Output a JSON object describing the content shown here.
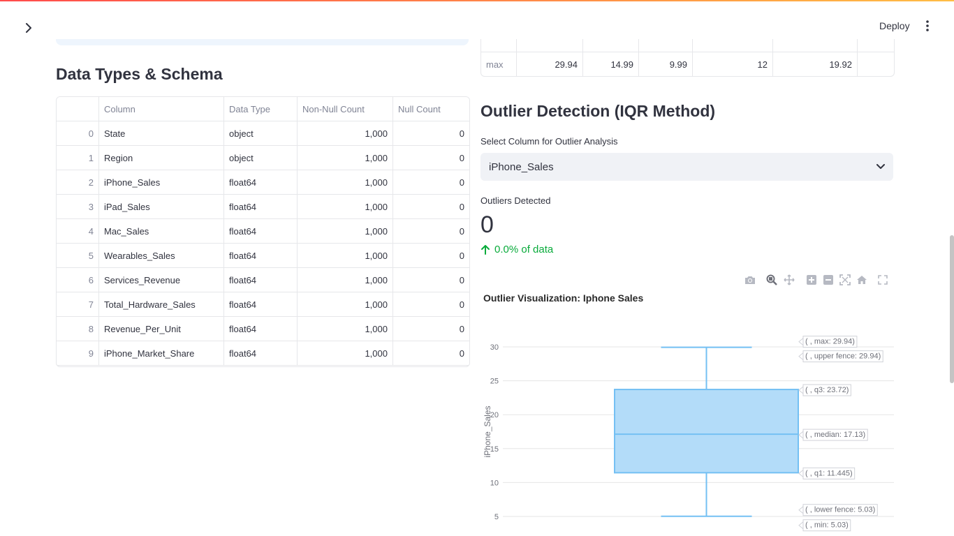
{
  "header": {
    "deploy_label": "Deploy",
    "sidebar_toggle_icon": "chevron-right-icon",
    "menu_icon": "kebab-menu-icon"
  },
  "schema": {
    "title": "Data Types & Schema",
    "columns": [
      "",
      "Column",
      "Data Type",
      "Non-Null Count",
      "Null Count"
    ],
    "rows": [
      {
        "idx": "0",
        "column": "State",
        "dtype": "object",
        "non_null": "1,000",
        "null": "0"
      },
      {
        "idx": "1",
        "column": "Region",
        "dtype": "object",
        "non_null": "1,000",
        "null": "0"
      },
      {
        "idx": "2",
        "column": "iPhone_Sales",
        "dtype": "float64",
        "non_null": "1,000",
        "null": "0"
      },
      {
        "idx": "3",
        "column": "iPad_Sales",
        "dtype": "float64",
        "non_null": "1,000",
        "null": "0"
      },
      {
        "idx": "4",
        "column": "Mac_Sales",
        "dtype": "float64",
        "non_null": "1,000",
        "null": "0"
      },
      {
        "idx": "5",
        "column": "Wearables_Sales",
        "dtype": "float64",
        "non_null": "1,000",
        "null": "0"
      },
      {
        "idx": "6",
        "column": "Services_Revenue",
        "dtype": "float64",
        "non_null": "1,000",
        "null": "0"
      },
      {
        "idx": "7",
        "column": "Total_Hardware_Sales",
        "dtype": "float64",
        "non_null": "1,000",
        "null": "0"
      },
      {
        "idx": "8",
        "column": "Revenue_Per_Unit",
        "dtype": "float64",
        "non_null": "1,000",
        "null": "0"
      },
      {
        "idx": "9",
        "column": "iPhone_Market_Share",
        "dtype": "float64",
        "non_null": "1,000",
        "null": "0"
      }
    ]
  },
  "stats": {
    "max_row": {
      "label": "max",
      "values": [
        "29.94",
        "14.99",
        "9.99",
        "12",
        "19.92",
        ""
      ]
    }
  },
  "outlier": {
    "title": "Outlier Detection (IQR Method)",
    "select_label": "Select Column for Outlier Analysis",
    "select_value": "iPhone_Sales",
    "metric_label": "Outliers Detected",
    "metric_value": "0",
    "metric_delta": "0.0% of data",
    "delta_color": "#09ab3b"
  },
  "chart_data": {
    "type": "box",
    "title": "Outlier Visualization: Iphone Sales",
    "ylabel": "iPhone_Sales",
    "ylim": [
      4,
      32
    ],
    "yticks": [
      5,
      10,
      15,
      20,
      25,
      30
    ],
    "box": {
      "min": 5.03,
      "lower_fence": 5.03,
      "q1": 11.445,
      "median": 17.13,
      "q3": 23.72,
      "upper_fence": 29.94,
      "max": 29.94
    },
    "annotations": [
      {
        "key": "max",
        "text": "( , max: 29.94)"
      },
      {
        "key": "upper_fence",
        "text": "( , upper fence: 29.94)"
      },
      {
        "key": "q3",
        "text": "( , q3: 23.72)"
      },
      {
        "key": "median",
        "text": "( , median: 17.13)"
      },
      {
        "key": "q1",
        "text": "( , q1: 11.445)"
      },
      {
        "key": "lower_fence",
        "text": "( , lower fence: 5.03)"
      },
      {
        "key": "min",
        "text": "( , min: 5.03)"
      }
    ],
    "colors": {
      "box_fill": "#b3dcf9",
      "box_line": "#74c0f3",
      "grid": "#e5e5e5"
    },
    "modebar_icons": [
      "camera-icon",
      "zoom-icon",
      "pan-icon",
      "zoom-in-icon",
      "zoom-out-icon",
      "autoscale-icon",
      "reset-axes-icon",
      "fullscreen-icon"
    ]
  }
}
